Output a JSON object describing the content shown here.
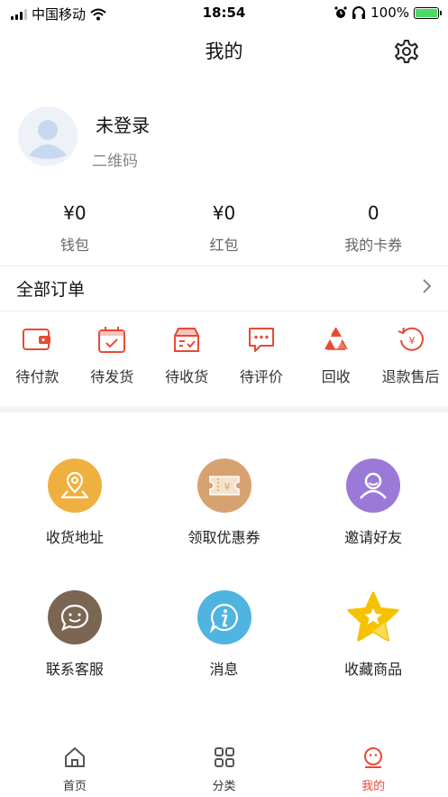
{
  "status_bar": {
    "carrier": "中国移动",
    "time": "18:54",
    "battery": "100%"
  },
  "header": {
    "title": "我的",
    "settings_icon": "gear-icon"
  },
  "profile": {
    "name": "未登录",
    "qr_label": "二维码"
  },
  "stats": [
    {
      "value": "¥0",
      "label": "钱包"
    },
    {
      "value": "¥0",
      "label": "红包"
    },
    {
      "value": "0",
      "label": "我的卡券"
    }
  ],
  "orders": {
    "title": "全部订单",
    "accent_color": "#e84a35",
    "items": [
      {
        "label": "待付款",
        "icon": "wallet-icon"
      },
      {
        "label": "待发货",
        "icon": "calendar-check-icon"
      },
      {
        "label": "待收货",
        "icon": "box-icon"
      },
      {
        "label": "待评价",
        "icon": "chat-bubble-icon"
      },
      {
        "label": "回收",
        "icon": "recycle-icon"
      },
      {
        "label": "退款售后",
        "icon": "refund-icon"
      }
    ]
  },
  "services": [
    {
      "label": "收货地址",
      "icon": "location-pin-icon",
      "color": "#f0b03f"
    },
    {
      "label": "领取优惠券",
      "icon": "coupon-icon",
      "color": "#d7a271"
    },
    {
      "label": "邀请好友",
      "icon": "user-icon",
      "color": "#9b79d8"
    },
    {
      "label": "联系客服",
      "icon": "smile-bubble-icon",
      "color": "#7b6553"
    },
    {
      "label": "消息",
      "icon": "info-icon",
      "color": "#4fb4e0"
    },
    {
      "label": "收藏商品",
      "icon": "star-icon",
      "color": "#f5c200"
    }
  ],
  "tabbar": [
    {
      "label": "首页",
      "icon": "home-icon",
      "active": false
    },
    {
      "label": "分类",
      "icon": "grid-icon",
      "active": false
    },
    {
      "label": "我的",
      "icon": "smile-face-icon",
      "active": true
    }
  ]
}
